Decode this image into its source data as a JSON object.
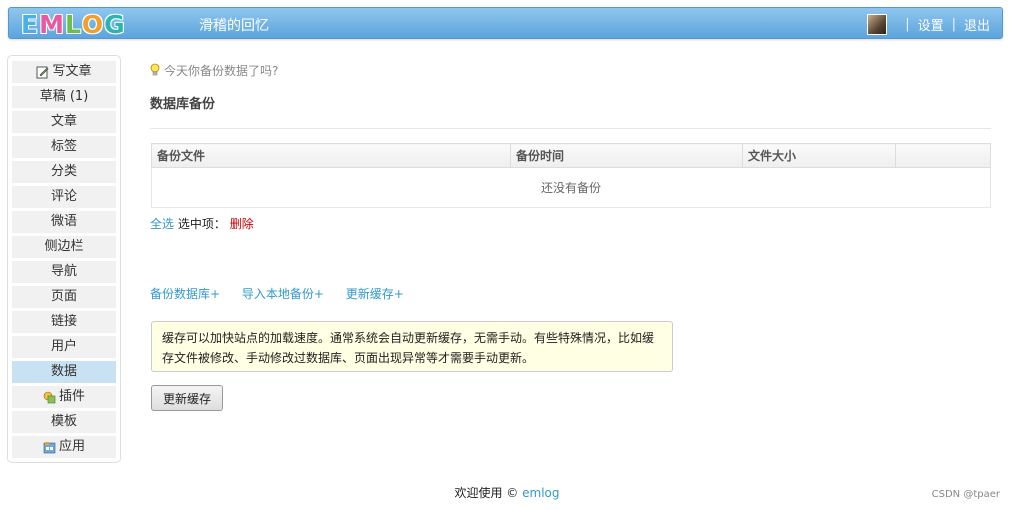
{
  "header": {
    "logo_letters": [
      {
        "ch": "E",
        "color": "#4ab0e8"
      },
      {
        "ch": "M",
        "color": "#e85aa0"
      },
      {
        "ch": "L",
        "color": "#6cc04a"
      },
      {
        "ch": "O",
        "color": "#f0a030"
      },
      {
        "ch": "G",
        "color": "#2bb5b0"
      }
    ],
    "site_title": "滑稽的回忆",
    "settings_label": "设置",
    "logout_label": "退出",
    "separator": "|"
  },
  "sidebar": {
    "items": [
      {
        "label": "写文章",
        "icon": "edit-icon"
      },
      {
        "label": "草稿 (1)"
      },
      {
        "label": "文章"
      },
      {
        "label": "标签"
      },
      {
        "label": "分类"
      },
      {
        "label": "评论"
      },
      {
        "label": "微语"
      },
      {
        "label": "侧边栏"
      },
      {
        "label": "导航"
      },
      {
        "label": "页面"
      },
      {
        "label": "链接"
      },
      {
        "label": "用户"
      },
      {
        "label": "数据",
        "active": true
      },
      {
        "label": "插件",
        "icon": "plugin-icon"
      },
      {
        "label": "模板"
      },
      {
        "label": "应用",
        "icon": "app-icon"
      }
    ]
  },
  "main": {
    "tip": "今天你备份数据了吗?",
    "section_title": "数据库备份",
    "table": {
      "headers": [
        "备份文件",
        "备份时间",
        "文件大小",
        ""
      ],
      "empty_text": "还没有备份"
    },
    "select_all": "全选",
    "selected_label": "选中项：",
    "delete_label": "删除",
    "actions": [
      "备份数据库+",
      "导入本地备份+",
      "更新缓存+"
    ],
    "notice": "缓存可以加快站点的加载速度。通常系统会自动更新缓存，无需手动。有些特殊情况，比如缓存文件被修改、手动修改过数据库、页面出现异常等才需要手动更新。",
    "update_cache_button": "更新缓存"
  },
  "footer": {
    "welcome": "欢迎使用 ©",
    "brand": "emlog"
  },
  "watermark": "CSDN @tpaer"
}
